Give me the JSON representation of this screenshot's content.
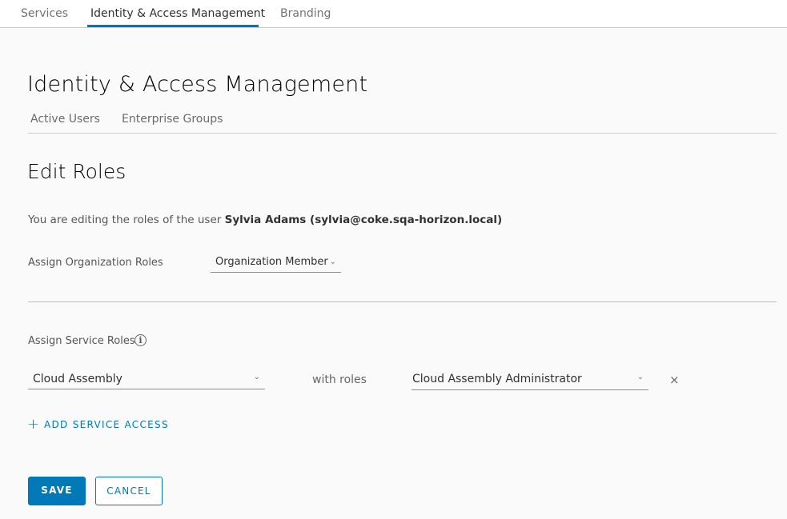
{
  "top_tabs": [
    {
      "label": "Services"
    },
    {
      "label": "Identity & Access Management",
      "active": true
    },
    {
      "label": "Branding"
    }
  ],
  "page_title": "Identity & Access Management",
  "sub_tabs": [
    {
      "label": "Active Users"
    },
    {
      "label": "Enterprise Groups"
    }
  ],
  "section_title": "Edit Roles",
  "intro": {
    "text": "You are editing the roles of the user ",
    "user": "Sylvia Adams (sylvia@coke.sqa-horizon.local)"
  },
  "org_roles": {
    "label": "Assign Organization Roles",
    "value": "Organization Member"
  },
  "service_roles": {
    "label": "Assign Service Roles",
    "info_icon": "info-icon",
    "rows": [
      {
        "service": "Cloud Assembly",
        "with_label": "with roles",
        "role": "Cloud Assembly Administrator",
        "remove_icon": "close-icon"
      }
    ]
  },
  "add_service": {
    "icon": "plus-icon",
    "label": "ADD SERVICE ACCESS"
  },
  "actions": {
    "save": "SAVE",
    "cancel": "CANCEL"
  },
  "colors": {
    "accent": "#0079b8",
    "background": "#fafafa"
  }
}
